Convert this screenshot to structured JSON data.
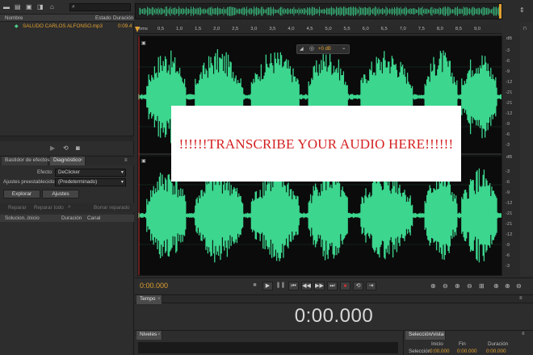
{
  "files": {
    "col_name": "Nombre",
    "col_state": "Estado",
    "col_duration": "Duración",
    "items": [
      {
        "name": "SALUDO CARLOS ALFONSO.mp3",
        "duration": "0:09.4"
      }
    ]
  },
  "effects": {
    "tabs": [
      "Bastidor de efectos",
      "Diagnóstico"
    ],
    "effect_label": "Efecto:",
    "effect_value": "DeClicker",
    "preset_label": "Ajustes preestablecidos:",
    "preset_value": "(Predeterminado)",
    "scan_button": "Explorar",
    "settings_button": "Ajustes",
    "toolbar": [
      "Reparar",
      "Reparar todo",
      "Borrar reparado"
    ],
    "columns": [
      "Solucion...",
      "Inicio",
      "Duración",
      "Canal"
    ]
  },
  "editor": {
    "ruler_unit": "hms",
    "ruler_ticks": [
      "0,5",
      "1,0",
      "1,5",
      "2,0",
      "2,5",
      "3,0",
      "3,5",
      "4,0",
      "4,5",
      "5,0",
      "5,5",
      "6,0",
      "6,5",
      "7,0",
      "7,5",
      "8,0",
      "8,5",
      "9,0"
    ],
    "gain_value": "+0 dB",
    "db_unit": "dB",
    "db_scale_top": [
      "-3",
      "-6",
      "-9",
      "-12",
      "-21",
      "-21",
      "-12",
      "-9",
      "-6",
      "-3"
    ],
    "db_scale_bottom": [
      "-3",
      "-6",
      "-9",
      "-12",
      "-21",
      "-21",
      "-12",
      "-9",
      "-6",
      "-3"
    ],
    "overlay_text": "!!!!!!TRANSCRIBE YOUR AUDIO HERE!!!!!!",
    "current_time": "0:00.000"
  },
  "time": {
    "tab": "Tempo",
    "display": "0:00.000"
  },
  "levels": {
    "tab": "Niveles"
  },
  "selection": {
    "tab": "Selección/vista",
    "col_start": "Inicio",
    "col_end": "Fin",
    "col_duration": "Duración",
    "row_label": "Selección",
    "start": "0:00.000",
    "end": "0:00.000",
    "duration": "0:00.000"
  },
  "colors": {
    "waveform": "#3cd68e",
    "playhead": "#e0a030",
    "overlay_text": "#d42020"
  }
}
